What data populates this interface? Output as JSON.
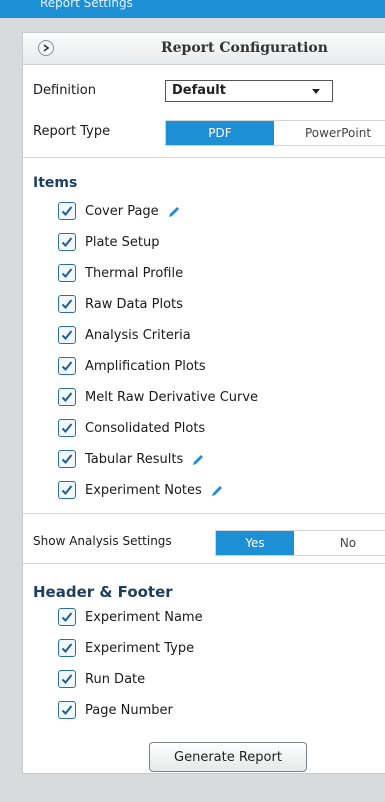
{
  "top_bar": {
    "text": "Report Settings"
  },
  "panel": {
    "title": "Report Configuration"
  },
  "definition": {
    "label": "Definition",
    "value": "Default"
  },
  "report_type": {
    "label": "Report Type",
    "options": [
      "PDF",
      "PowerPoint"
    ],
    "selected": "PDF"
  },
  "items": {
    "title": "Items",
    "list": [
      {
        "label": "Cover Page",
        "checked": true,
        "editable": true
      },
      {
        "label": "Plate Setup",
        "checked": true,
        "editable": false
      },
      {
        "label": "Thermal Profile",
        "checked": true,
        "editable": false
      },
      {
        "label": "Raw Data Plots",
        "checked": true,
        "editable": false
      },
      {
        "label": "Analysis Criteria",
        "checked": true,
        "editable": false
      },
      {
        "label": "Amplification Plots",
        "checked": true,
        "editable": false
      },
      {
        "label": "Melt Raw Derivative Curve",
        "checked": true,
        "editable": false
      },
      {
        "label": "Consolidated Plots",
        "checked": true,
        "editable": false
      },
      {
        "label": "Tabular Results",
        "checked": true,
        "editable": true
      },
      {
        "label": "Experiment Notes",
        "checked": true,
        "editable": true
      }
    ]
  },
  "analysis_settings": {
    "label": "Show Analysis Settings",
    "options": [
      "Yes",
      "No"
    ],
    "selected": "Yes"
  },
  "header_footer": {
    "title": "Header & Footer",
    "list": [
      {
        "label": "Experiment Name",
        "checked": true
      },
      {
        "label": "Experiment Type",
        "checked": true
      },
      {
        "label": "Run Date",
        "checked": true
      },
      {
        "label": "Page Number",
        "checked": true
      }
    ]
  },
  "generate_button": {
    "label": "Generate Report"
  },
  "colors": {
    "accent": "#1d8fd4",
    "section_title": "#1c3f5f",
    "checkbox_border": "#2c6fa3"
  }
}
